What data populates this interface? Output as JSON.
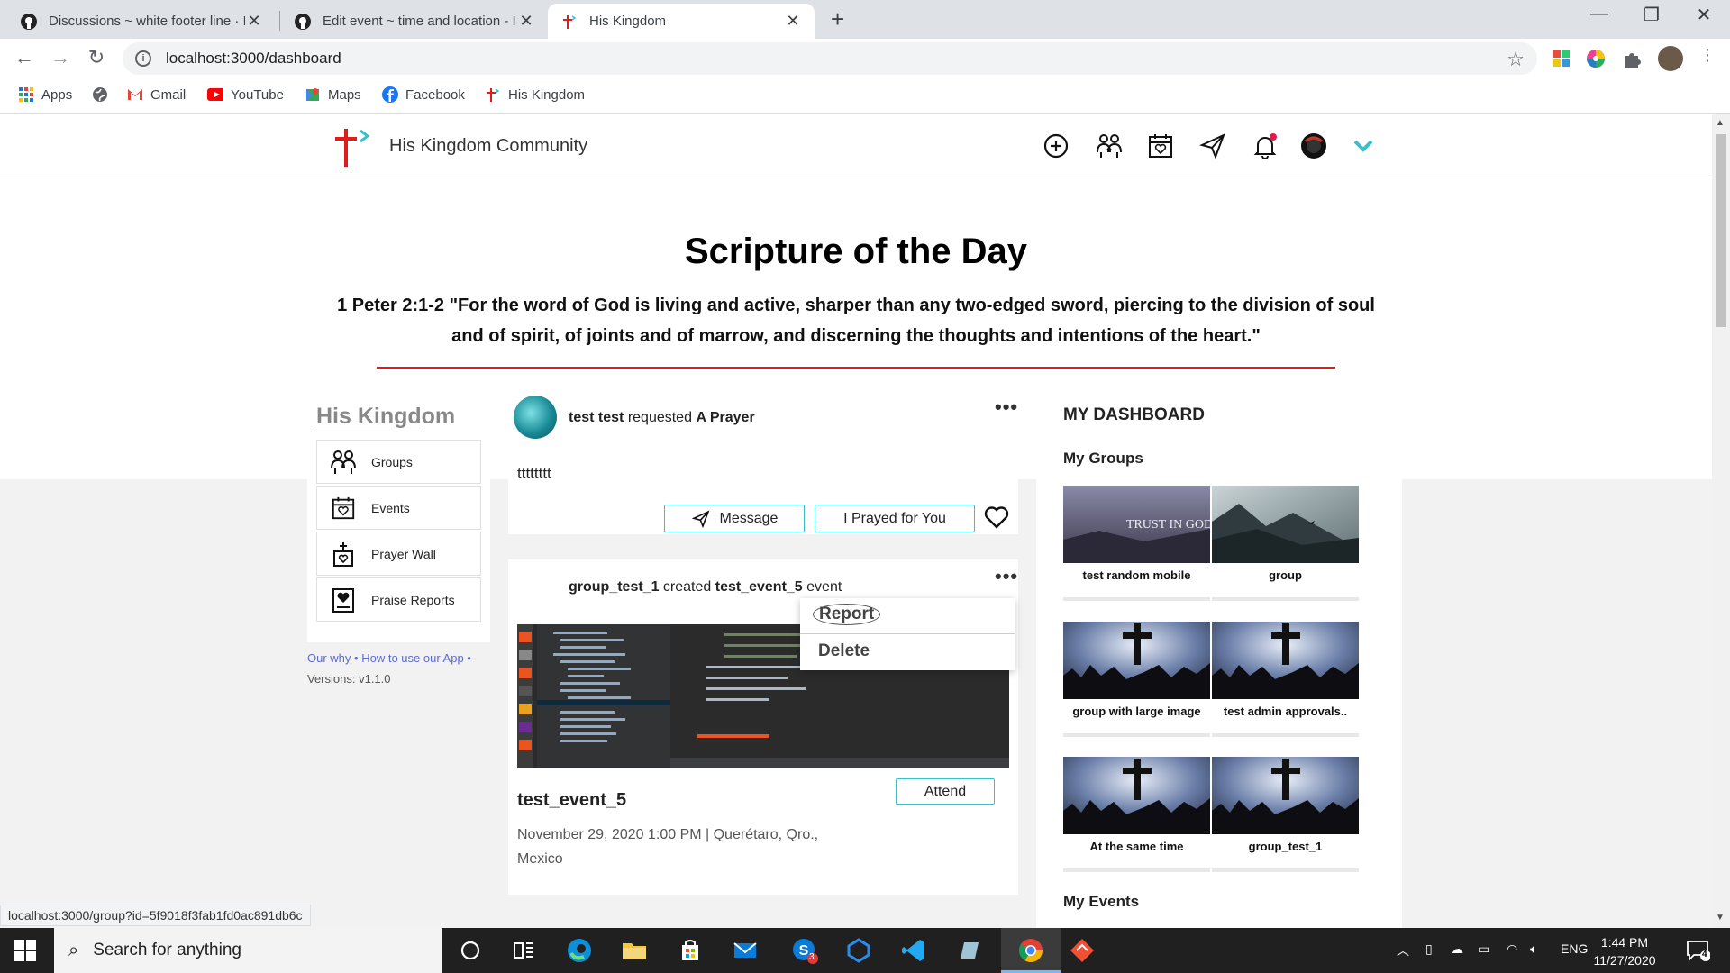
{
  "browser": {
    "tabs": [
      {
        "title": "Discussions ~ white footer line · I",
        "close": "✕"
      },
      {
        "title": "Edit event ~ time and location - I",
        "close": "✕"
      },
      {
        "title": "His Kingdom",
        "close": "✕"
      }
    ],
    "new_tab": "+",
    "url": "localhost:3000/dashboard",
    "bookmarks": [
      "Apps",
      "Gmail",
      "YouTube",
      "Maps",
      "Facebook",
      "His Kingdom"
    ],
    "status_url": "localhost:3000/group?id=5f9018f3fab1fd0ac891db6c"
  },
  "app": {
    "brand": "His Kingdom Community",
    "accent": "#39c0cc",
    "brand_red": "#e21b1b",
    "header_icons": [
      "plus-circle-icon",
      "groups-icon",
      "calendar-heart-icon",
      "send-icon",
      "bell-icon",
      "profile-avatar",
      "chevron-down-icon"
    ]
  },
  "scripture": {
    "title": "Scripture of the Day",
    "text": "1 Peter 2:1-2 \"For the word of God is living and active, sharper than any two-edged sword, piercing to the division of soul and of spirit, of joints and of marrow, and discerning the thoughts and intentions of the heart.\""
  },
  "sidebar": {
    "title": "His Kingdom",
    "items": [
      {
        "label": "Groups",
        "icon": "groups-icon"
      },
      {
        "label": "Events",
        "icon": "calendar-icon"
      },
      {
        "label": "Prayer Wall",
        "icon": "prayer-wall-icon"
      },
      {
        "label": "Praise Reports",
        "icon": "praise-reports-icon"
      }
    ],
    "links": [
      "Our why",
      "•",
      "How to use our App",
      "•"
    ],
    "version": "Versions: v1.1.0"
  },
  "feed": {
    "post1": {
      "user": "test test",
      "verb": "requested",
      "object": "A Prayer",
      "body": "tttttttt",
      "message_btn": "Message",
      "prayed_btn": "I Prayed for You",
      "more": "•••"
    },
    "post2": {
      "group": "group_test_1",
      "verb": "created",
      "event": "test_event_5",
      "suffix": "event",
      "title": "test_event_5",
      "meta": "November 29, 2020 1:00 PM | Querétaro, Qro., Mexico",
      "attend_btn": "Attend",
      "more": "•••"
    },
    "context_menu": {
      "report": "Report",
      "delete": "Delete"
    }
  },
  "dashboard": {
    "title": "MY DASHBOARD",
    "groups_heading": "My Groups",
    "groups": [
      {
        "name": "test random mobile",
        "image": "trust-in-god"
      },
      {
        "name": "group",
        "image": "misty-mountains"
      },
      {
        "name": "group with large image",
        "image": "cross-crowd"
      },
      {
        "name": "test admin approvals..",
        "image": "cross-crowd"
      },
      {
        "name": "At the same time",
        "image": "cross-crowd"
      },
      {
        "name": "group_test_1",
        "image": "cross-crowd"
      }
    ],
    "trust_text": "TRUST IN GOD",
    "events_heading": "My Events"
  },
  "taskbar": {
    "search": "Search for anything",
    "lang": "ENG",
    "time": "1:44 PM",
    "date": "11/27/2020",
    "notif_count": "4",
    "badge": "3"
  }
}
